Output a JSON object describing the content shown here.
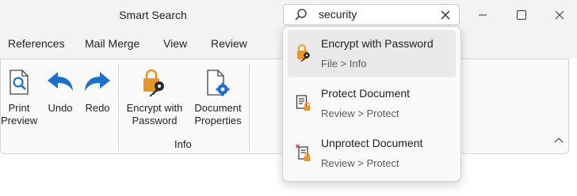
{
  "window": {
    "title": "Smart Search"
  },
  "search": {
    "query": "security"
  },
  "menu": {
    "items": [
      "References",
      "Mail Merge",
      "View",
      "Review"
    ]
  },
  "ribbon": {
    "buttons": {
      "print_preview": {
        "line1": "Print",
        "line2": "Preview",
        "icon": "print-preview-icon"
      },
      "undo": {
        "label": "Undo",
        "icon": "undo-arrow-icon"
      },
      "redo": {
        "label": "Redo",
        "icon": "redo-arrow-icon"
      },
      "encrypt": {
        "line1": "Encrypt with",
        "line2": "Password",
        "icon": "lock-key-icon"
      },
      "doc_props": {
        "line1": "Document",
        "line2": "Properties",
        "icon": "document-gear-icon"
      }
    },
    "group_info_label": "Info"
  },
  "results": [
    {
      "title": "Encrypt with Password",
      "path": "File > Info",
      "icon": "lock-key-icon",
      "selected": true
    },
    {
      "title": "Protect Document",
      "path": "Review > Protect",
      "icon": "document-lock-icon",
      "selected": false
    },
    {
      "title": "Unprotect Document",
      "path": "Review > Protect",
      "icon": "document-unlock-icon",
      "selected": false
    }
  ],
  "colors": {
    "accent_blue": "#1e6fcc",
    "lock_orange": "#e8952a",
    "titlebar": "#f3f3f3"
  }
}
